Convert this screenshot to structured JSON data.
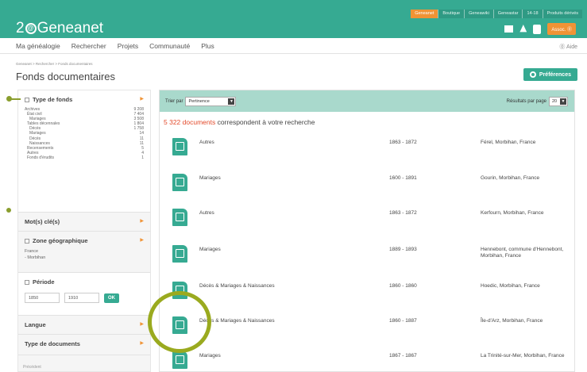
{
  "header": {
    "top_tabs": [
      "Geneanet",
      "Boutique",
      "Geneawiki",
      "Geneastar",
      "14-18",
      "Produits dérivés"
    ],
    "logo_prefix": "2",
    "logo_mark": "@",
    "logo_text": "Geneanet",
    "account_label": "Assoc. ⓪"
  },
  "nav": {
    "items": [
      "Ma généalogie",
      "Rechercher",
      "Projets",
      "Communauté",
      "Plus"
    ],
    "help": "⓪ Aide"
  },
  "breadcrumb": "Geneanet > Rechercher > Fonds documentaires",
  "page_title": "Fonds documentaires",
  "preferences_label": "Préférences",
  "sidebar": {
    "type_head": "Type de fonds",
    "counts": [
      {
        "label": "Archives",
        "count": "9 208",
        "level": 0
      },
      {
        "label": "État civil",
        "count": "7 404",
        "level": 1
      },
      {
        "label": "Mariages",
        "count": "3 508",
        "level": 2
      },
      {
        "label": "Tables décennales",
        "count": "1 804",
        "level": 1
      },
      {
        "label": "Décès",
        "count": "1 758",
        "level": 2
      },
      {
        "label": "Mariages",
        "count": "14",
        "level": 2
      },
      {
        "label": "Décès",
        "count": "11",
        "level": 2
      },
      {
        "label": "Naissances",
        "count": "11",
        "level": 2
      },
      {
        "label": "Recensements",
        "count": "5",
        "level": 1
      },
      {
        "label": "Autres",
        "count": "4",
        "level": 1
      },
      {
        "label": "Fonds d'érudits",
        "count": "1",
        "level": 1
      }
    ],
    "keywords_head": "Mot(s) clé(s)",
    "geo_head": "Zone géographique",
    "geo_lines": [
      "France",
      "- Morbihan"
    ],
    "period_head": "Période",
    "date_from": "1850",
    "date_to": "1910",
    "ok_label": "OK",
    "language_head": "Langue",
    "doctype_head": "Type de documents",
    "footer": "Précédent"
  },
  "results": {
    "sort_label": "Trier par",
    "sort_value": "Pertinence",
    "per_page_label": "Résultats par page",
    "per_page_value": "20",
    "count_number": "5 322 documents",
    "count_text": " correspondent à votre recherche",
    "rows": [
      {
        "type": "Autres",
        "years": "1863 - 1872",
        "place": "Férel, Morbihan, France"
      },
      {
        "type": "Mariages",
        "years": "1600 - 1891",
        "place": "Gourin, Morbihan, France"
      },
      {
        "type": "Autres",
        "years": "1863 - 1872",
        "place": "Kerfourn, Morbihan, France"
      },
      {
        "type": "Mariages",
        "years": "1889 - 1893",
        "place": "Hennebont, commune d'Hennebont, Morbihan, France"
      },
      {
        "type": "Décès & Mariages & Naissances",
        "years": "1860 - 1860",
        "place": "Hoedic, Morbihan, France"
      },
      {
        "type": "Décès & Mariages & Naissances",
        "years": "1860 - 1887",
        "place": "Île-d'Arz, Morbihan, France"
      },
      {
        "type": "Mariages",
        "years": "1867 - 1867",
        "place": "La Trinité-sur-Mer, Morbihan, France"
      }
    ]
  },
  "colors": {
    "brand": "#36aa92",
    "accent": "#f09335",
    "count": "#e34b2c",
    "callout": "#9aaa1f"
  }
}
